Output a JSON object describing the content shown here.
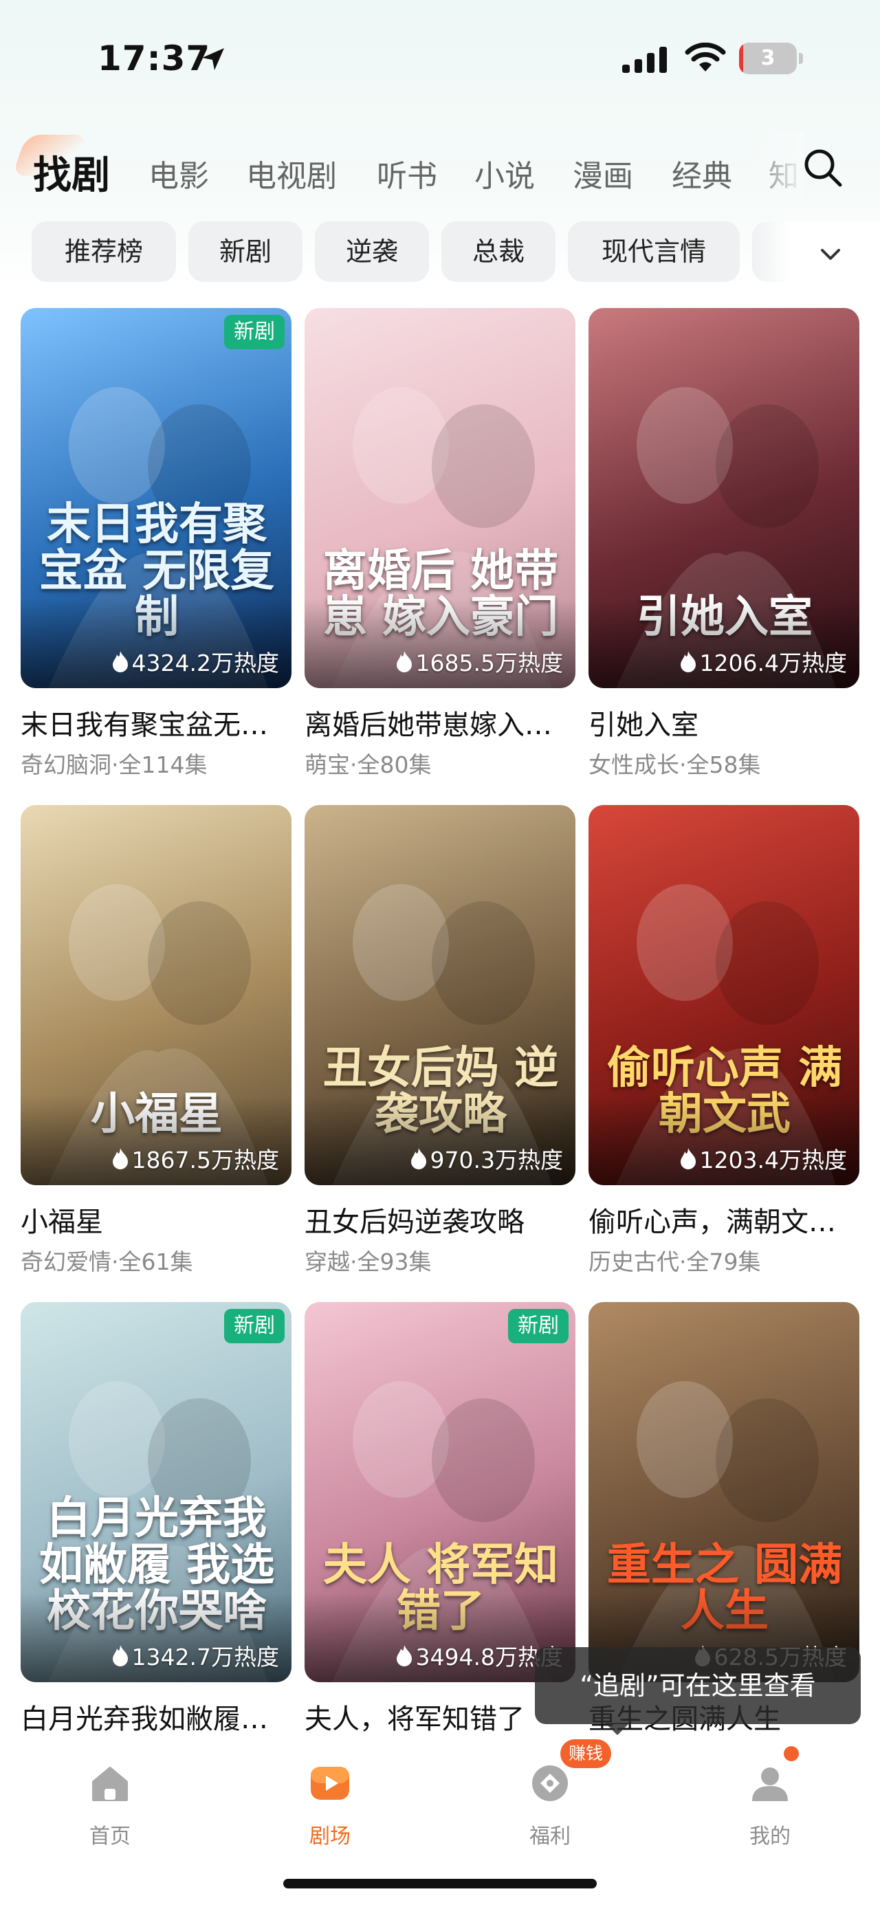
{
  "status_bar": {
    "time": "17:37",
    "battery_level": "3",
    "battery_fraction": 0.03
  },
  "top_nav": {
    "tabs": [
      {
        "label": "找剧",
        "active": true
      },
      {
        "label": "电影"
      },
      {
        "label": "电视剧"
      },
      {
        "label": "听书"
      },
      {
        "label": "小说"
      },
      {
        "label": "漫画"
      },
      {
        "label": "经典"
      },
      {
        "label": "知"
      }
    ],
    "search_icon": "search-icon"
  },
  "filter_chips": [
    "推荐榜",
    "新剧",
    "逆袭",
    "总裁",
    "现代言情"
  ],
  "cards": [
    {
      "title": "末日我有聚宝盆无…",
      "meta": "奇幻脑洞·全114集",
      "heat": "4324.2万热度",
      "badge": "新剧",
      "poster_text": "末日我有聚宝盆 无限复制",
      "colors": [
        "#7fc2ff",
        "#2a6fb8",
        "#0d2a55"
      ],
      "poster_color": "#e8f6ff"
    },
    {
      "title": "离婚后她带崽嫁入…",
      "meta": "萌宝·全80集",
      "heat": "1685.5万热度",
      "badge": "",
      "poster_text": "离婚后 她带崽 嫁入豪门",
      "colors": [
        "#f6dfe3",
        "#e8b9c2",
        "#b98a96"
      ],
      "poster_color": "#ffffff"
    },
    {
      "title": "引她入室",
      "meta": "女性成长·全58集",
      "heat": "1206.4万热度",
      "badge": "",
      "poster_text": "引她入室",
      "colors": [
        "#c97a7e",
        "#6d2b34",
        "#2a0d12"
      ],
      "poster_color": "#ffffff"
    },
    {
      "title": "小福星",
      "meta": "奇幻爱情·全61集",
      "heat": "1867.5万热度",
      "badge": "",
      "poster_text": "小福星",
      "colors": [
        "#e9d9b4",
        "#a88c5e",
        "#5c4a32"
      ],
      "poster_color": "#ffffff"
    },
    {
      "title": "丑女后妈逆袭攻略",
      "meta": "穿越·全93集",
      "heat": "970.3万热度",
      "badge": "",
      "poster_text": "丑女后妈 逆袭攻略",
      "colors": [
        "#cbb48c",
        "#7c6446",
        "#2e2418"
      ],
      "poster_color": "#f7e6b5"
    },
    {
      "title": "偷听心声，满朝文…",
      "meta": "历史古代·全79集",
      "heat": "1203.4万热度",
      "badge": "",
      "poster_text": "偷听心声 满朝文武",
      "colors": [
        "#d8473a",
        "#8f1f1a",
        "#3b0c0a"
      ],
      "poster_color": "#ffd76a"
    },
    {
      "title": "白月光弃我如敝履…",
      "meta": "",
      "heat": "1342.7万热度",
      "badge": "新剧",
      "poster_text": "白月光弃我如敝履 我选校花你哭啥",
      "colors": [
        "#cfe6e8",
        "#9fbcc7",
        "#4e6d7d"
      ],
      "poster_color": "#ffffff"
    },
    {
      "title": "夫人，将军知错了",
      "meta": "",
      "heat": "3494.8万热度",
      "badge": "新剧",
      "poster_text": "夫人 将军知错了",
      "colors": [
        "#f4c6d3",
        "#c9879d",
        "#6c3a4c"
      ],
      "poster_color": "#ffe08a"
    },
    {
      "title": "重生之圆满人生",
      "meta": "",
      "heat": "628.5万热度",
      "badge": "",
      "poster_text": "重生之 圆满人生",
      "colors": [
        "#b08a63",
        "#6b4f37",
        "#2c2016"
      ],
      "poster_color": "#ff5a2a"
    }
  ],
  "toast": {
    "text": "“追剧”可在这里查看"
  },
  "tab_bar": {
    "items": [
      {
        "label": "首页",
        "icon": "home-icon"
      },
      {
        "label": "剧场",
        "icon": "theater-play-icon",
        "active": true
      },
      {
        "label": "福利",
        "icon": "coin-icon",
        "badge": "赚钱"
      },
      {
        "label": "我的",
        "icon": "profile-icon"
      }
    ]
  },
  "accent_color": "#f26b1d",
  "badge_color": "#18b07c"
}
